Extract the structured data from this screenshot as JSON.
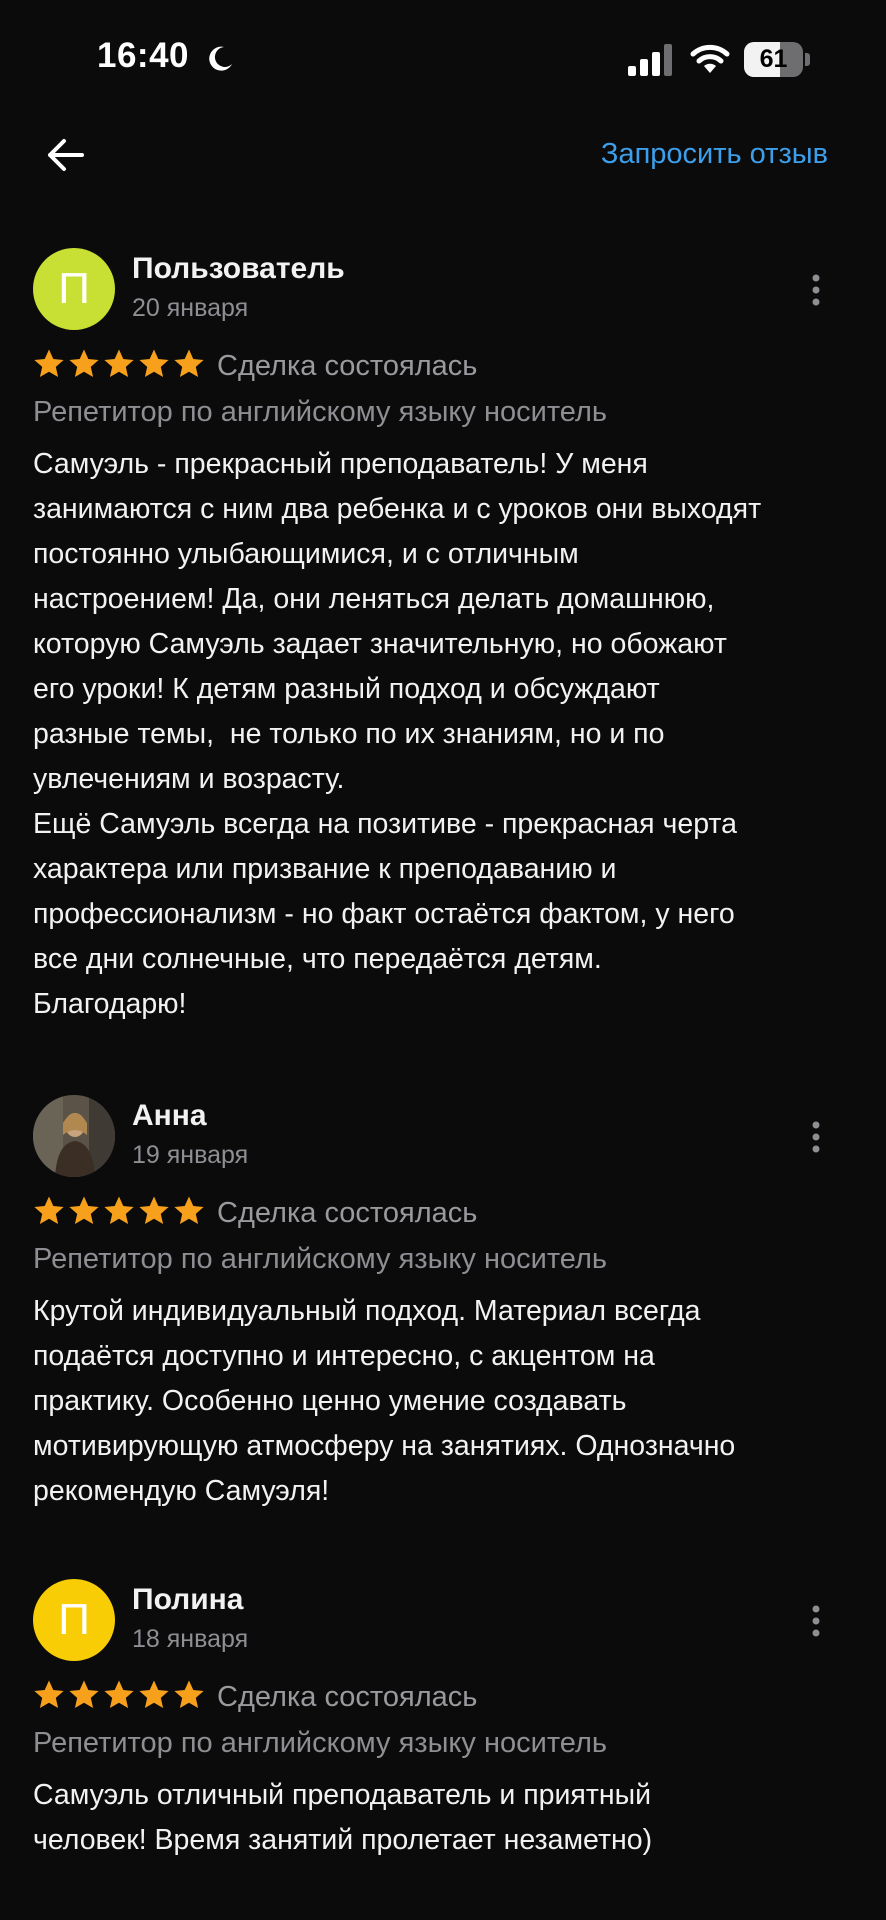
{
  "status_bar": {
    "time": "16:40",
    "battery_level": "61",
    "icons": [
      "moon-icon",
      "cellular-signal-icon",
      "wifi-icon",
      "battery-icon"
    ]
  },
  "header": {
    "request_review_label": "Запросить отзыв",
    "back_icon": "arrow-left-icon"
  },
  "colors": {
    "background": "#0b0b0c",
    "accent": "#3d9fea",
    "star": "#f7a01b",
    "avatar_lime": "#c8e033",
    "avatar_yellow": "#f8cd06"
  },
  "reviews": [
    {
      "avatar_letter": "П",
      "avatar_color": "#c8e033",
      "name": "Пользователь",
      "date": "20 января",
      "rating": 5,
      "deal_status": "Сделка состоялась",
      "service": "Репетитор по английскому языку носитель",
      "text": "Самуэль - прекрасный преподаватель! У меня\nзанимаются с ним два ребенка и с уроков они выходят\nпостоянно улыбающимися, и с отличным\nнастроением! Да, они леняться делать домашнюю,\nкоторую Самуэль задает значительную, но обожают\nего уроки! К детям разный подход и обсуждают\nразные темы,  не только по их знаниям, но и по\nувлечениям и возрасту.\nЕщё Самуэль всегда на позитиве - прекрасная черта\nхарактера или призвание к преподаванию и\nпрофессионализм - но факт остаётся фактом, у него\nвсе дни солнечные, что передаётся детям.\nБлагодарю!"
    },
    {
      "avatar_letter": "",
      "avatar_color": "#4a4238",
      "name": "Анна",
      "date": "19 января",
      "rating": 5,
      "deal_status": "Сделка состоялась",
      "service": "Репетитор по английскому языку носитель",
      "text": "Крутой индивидуальный подход. Материал всегда\nподаётся доступно и интересно, с акцентом на\nпрактику. Особенно ценно умение создавать\nмотивирующую атмосферу на занятиях. Однозначно\nрекомендую Самуэля!"
    },
    {
      "avatar_letter": "П",
      "avatar_color": "#f8cd06",
      "name": "Полина",
      "date": "18 января",
      "rating": 5,
      "deal_status": "Сделка состоялась",
      "service": "Репетитор по английскому языку носитель",
      "text": "Самуэль отличный преподаватель и приятный\nчеловек! Время занятий пролетает незаметно)"
    }
  ]
}
